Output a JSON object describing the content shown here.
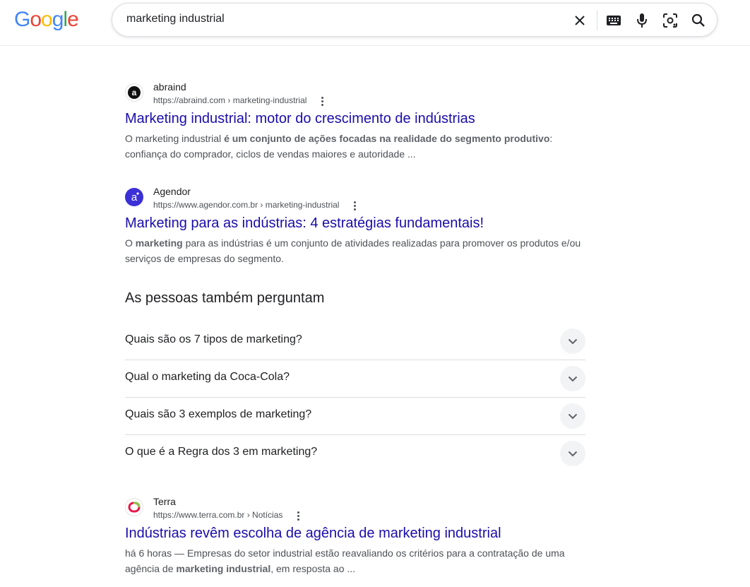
{
  "logo": {
    "letters": [
      "G",
      "o",
      "o",
      "g",
      "l",
      "e"
    ],
    "colors": [
      "#4285f4",
      "#ea4335",
      "#fbbc05",
      "#4285f4",
      "#34a853",
      "#ea4335"
    ]
  },
  "search": {
    "query": "marketing industrial",
    "icons": [
      "close-icon",
      "keyboard-icon",
      "microphone-icon",
      "lens-icon",
      "search-icon"
    ]
  },
  "results": [
    {
      "site": "abraind",
      "url": "https://abraind.com › marketing-industrial",
      "title": "Marketing industrial: motor do crescimento de indústrias",
      "snippet_line1_pre": "O marketing industrial ",
      "snippet_line1_bold": "é um conjunto de ações focadas na realidade do segmento produtivo",
      "snippet_line1_post": ":",
      "snippet_line2": "confiança do comprador, ciclos de vendas maiores e autoridade ..."
    },
    {
      "site": "Agendor",
      "url": "https://www.agendor.com.br › marketing-industrial",
      "title": "Marketing para as indústrias: 4 estratégias fundamentais!",
      "snippet_line1_pre": "O ",
      "snippet_line1_bold": "marketing",
      "snippet_line1_post": " para as indústrias é um conjunto de atividades realizadas para promover os produtos e/ou",
      "snippet_line2": "serviços de empresas do segmento."
    },
    {
      "site": "Terra",
      "url": "https://www.terra.com.br › Notícias",
      "title": "Indústrias revêm escolha de agência de marketing industrial",
      "snippet_line1_pre": "há 6 horas — Empresas do setor industrial estão reavaliando os critérios para a contratação de uma",
      "snippet_line2_pre": "agência de ",
      "snippet_line2_bold": "marketing industrial",
      "snippet_line2_post": ", em resposta ao ..."
    }
  ],
  "paa": {
    "heading": "As pessoas também perguntam",
    "questions": [
      "Quais são os 7 tipos de marketing?",
      "Qual o marketing da Coca-Cola?",
      "Quais são 3 exemplos de marketing?",
      "O que é a Regra dos 3 em marketing?"
    ]
  }
}
